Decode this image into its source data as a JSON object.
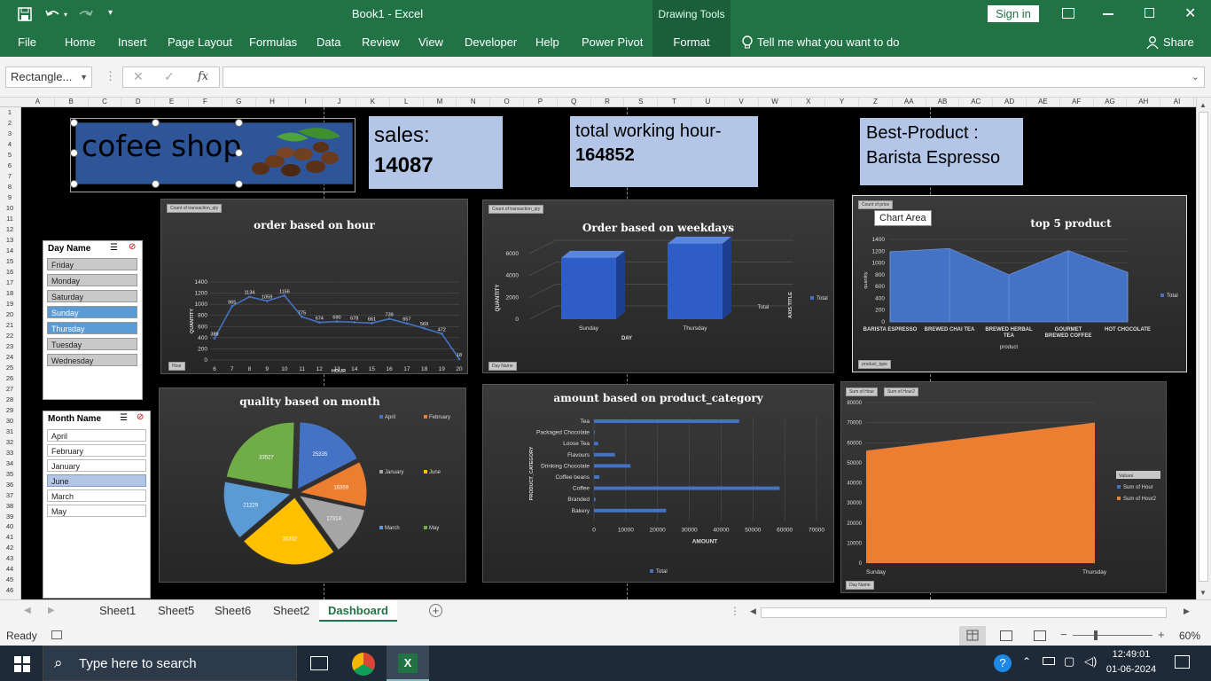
{
  "titlebar": {
    "title": "Book1  -  Excel",
    "context_tab": "Drawing Tools",
    "sign_in": "Sign in"
  },
  "ribbon": {
    "tabs": [
      "File",
      "Home",
      "Insert",
      "Page Layout",
      "Formulas",
      "Data",
      "Review",
      "View",
      "Developer",
      "Help",
      "Power Pivot",
      "Format"
    ],
    "tell_me": "Tell me what you want to do",
    "share": "Share"
  },
  "formula_bar": {
    "name_box": "Rectangle...",
    "fx": "fx",
    "value": ""
  },
  "columns": [
    "A",
    "B",
    "C",
    "D",
    "E",
    "F",
    "G",
    "H",
    "I",
    "J",
    "K",
    "L",
    "M",
    "N",
    "O",
    "P",
    "Q",
    "R",
    "S",
    "T",
    "U",
    "V",
    "W",
    "X",
    "Y",
    "Z",
    "AA",
    "AB",
    "AC",
    "AD",
    "AE",
    "AF",
    "AG",
    "AH",
    "AI"
  ],
  "rows": [
    "1",
    "2",
    "3",
    "4",
    "5",
    "6",
    "7",
    "8",
    "9",
    "10",
    "11",
    "12",
    "13",
    "14",
    "15",
    "16",
    "17",
    "18",
    "19",
    "20",
    "21",
    "22",
    "23",
    "24",
    "25",
    "26",
    "27",
    "28",
    "29",
    "30",
    "31",
    "32",
    "33",
    "34",
    "35",
    "36",
    "37",
    "38",
    "39",
    "40",
    "41",
    "42",
    "43",
    "44",
    "45",
    "46"
  ],
  "dashboard": {
    "logo_text": "cofee shop",
    "sales_label": "sales:",
    "sales_value": "14087",
    "hours_label": "total working hour-",
    "hours_value": "164852",
    "best_label": "Best-Product :",
    "best_value": "Barista Espresso"
  },
  "slicers": {
    "day": {
      "title": "Day Name",
      "items": [
        "Friday",
        "Monday",
        "Saturday",
        "Sunday",
        "Thursday",
        "Tuesday",
        "Wednesday"
      ],
      "selected": [
        "Sunday",
        "Thursday"
      ]
    },
    "month": {
      "title": "Month Name",
      "items": [
        "April",
        "February",
        "January",
        "June",
        "March",
        "May"
      ],
      "selected": [
        "June"
      ]
    }
  },
  "tooltip": "Chart Area",
  "chart_data": [
    {
      "type": "line",
      "title": "order based on hour",
      "xlabel": "HOUR",
      "ylabel": "QUANTITY",
      "field_button": "Count of transaction_qty",
      "filter_button": "Hour",
      "x": [
        "6",
        "7",
        "8",
        "9",
        "10",
        "11",
        "12",
        "13",
        "14",
        "15",
        "16",
        "17",
        "18",
        "19",
        "20"
      ],
      "values": [
        389,
        965,
        1134,
        1059,
        1156,
        775,
        674,
        690,
        678,
        661,
        739,
        657,
        569,
        472,
        18
      ],
      "ylim": [
        0,
        1400
      ],
      "yticks": [
        "0",
        "200",
        "400",
        "600",
        "800",
        "1000",
        "1200",
        "1400"
      ],
      "color": "#4472c4"
    },
    {
      "type": "bar",
      "title": "Order based on weekdays",
      "xlabel": "DAY",
      "ylabel": "QUANTITY",
      "zlabel": "AXIS TITLE",
      "field_button": "Count of transaction_qty",
      "filter_button": "Day Name",
      "categories": [
        "Sunday",
        "Thursday"
      ],
      "values": [
        5600,
        6900
      ],
      "ylim": [
        0,
        6000
      ],
      "yticks": [
        "0",
        "2000",
        "4000",
        "6000"
      ],
      "series_label": "Total",
      "legend": "Total",
      "color": "#4472c4"
    },
    {
      "type": "area",
      "title": "top 5 product",
      "xlabel": "product",
      "ylabel": "quantity",
      "field_button": "Count of price",
      "filter_button": "product_type",
      "categories": [
        "BARISTA ESPRESSO",
        "BREWED CHAI TEA",
        "BREWED HERBAL TEA",
        "GOURMET BREWED COFFEE",
        "HOT CHOCOLATE"
      ],
      "values": [
        1190,
        1245,
        800,
        1210,
        840
      ],
      "ylim": [
        0,
        1400
      ],
      "yticks": [
        "0",
        "200",
        "400",
        "600",
        "800",
        "1000",
        "1200",
        "1400"
      ],
      "legend": "Total",
      "color": "#4472c4"
    },
    {
      "type": "pie",
      "title": "quality based on month",
      "legend_placement": "right",
      "labels": [
        "April",
        "February",
        "January",
        "June",
        "March",
        "May"
      ],
      "values": [
        25335,
        16359,
        17314,
        35352,
        21229,
        33527
      ],
      "colors": [
        "#4472c4",
        "#ed7d31",
        "#a5a5a5",
        "#ffc000",
        "#5b9bd5",
        "#70ad47"
      ]
    },
    {
      "type": "bar",
      "orientation": "horizontal",
      "title": "amount based on product_category",
      "xlabel": "AMOUNT",
      "ylabel": "PRODUCT_CATEGORY",
      "categories": [
        "Tea",
        "Packaged Chocolate",
        "Loose Tea",
        "Flavours",
        "Drinking Chocolate",
        "Coffee beans",
        "Coffee",
        "Branded",
        "Bakery"
      ],
      "values": [
        45700,
        200,
        1300,
        6600,
        11500,
        1700,
        58400,
        500,
        22700
      ],
      "xlim": [
        0,
        70000
      ],
      "xticks": [
        "0",
        "10000",
        "20000",
        "30000",
        "40000",
        "50000",
        "60000",
        "70000"
      ],
      "legend": "Total",
      "color": "#4472c4"
    },
    {
      "type": "area",
      "title": "",
      "field_buttons": [
        "Sum of Hour",
        "Sum of Hour2"
      ],
      "filter_button": "Day Name",
      "categories": [
        "Sunday",
        "Thursday"
      ],
      "series": [
        {
          "name": "Sum of Hour",
          "values": [
            56000,
            70000
          ]
        },
        {
          "name": "Sum of Hour2",
          "values": [
            56000,
            70000
          ]
        }
      ],
      "ylim": [
        0,
        80000
      ],
      "yticks": [
        "0",
        "10000",
        "20000",
        "30000",
        "40000",
        "50000",
        "60000",
        "70000",
        "80000"
      ],
      "legend_title": "Values",
      "colors": [
        "#4472c4",
        "#ed7d31"
      ]
    }
  ],
  "sheet_tabs": [
    "Sheet1",
    "Sheet5",
    "Sheet6",
    "Sheet2",
    "Dashboard"
  ],
  "active_sheet": "Dashboard",
  "statusbar": {
    "status": "Ready",
    "zoom": "60%"
  },
  "taskbar": {
    "search_placeholder": "Type here to search",
    "time": "12:49:01",
    "date": "01-06-2024"
  }
}
